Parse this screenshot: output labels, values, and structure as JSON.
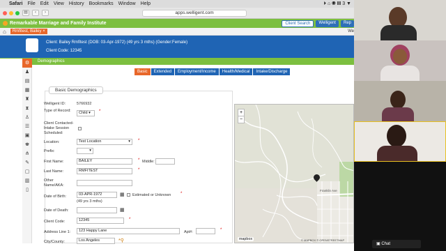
{
  "menubar": {
    "items": [
      "Safari",
      "File",
      "Edit",
      "View",
      "History",
      "Bookmarks",
      "Window",
      "Help"
    ],
    "right": "⏵ ⌂ ◉ ▤ 3 ▼"
  },
  "browser": {
    "url": "apps.welligent.com",
    "traffic_colors": [
      "#ff5f57",
      "#febc2e",
      "#28c840"
    ]
  },
  "app": {
    "title": "Remarkable Marriage and Family Institute",
    "client_search_label": "Client Search",
    "welligent_label": "Welligent",
    "rep_label": "Rep",
    "client_tab_label": "Rmfitest, Bailey",
    "welcome_text": "We",
    "client_line1": "Client: Bailey Rmfitest (DOB: 03-Apr-1972) (49 yrs 3 mths) (Gender:Female)",
    "client_line2": "Client Code: 12345",
    "section_title": "Demographics",
    "tabs": [
      "Basic",
      "Extended",
      "Employment/Income",
      "Health/Medical",
      "Intake/Discharge"
    ],
    "active_tab": "Basic"
  },
  "form": {
    "group_title": "Basic Demographics",
    "welligent_id_label": "Welligent ID:",
    "welligent_id_value": "5766932",
    "type_of_record_label": "Type of Record:",
    "type_of_record_value": "Child",
    "contacted_label": "Client Contacted-Intake Session Scheduled:",
    "location_label": "Location:",
    "location_value": "Test Location",
    "prefix_label": "Prefix:",
    "first_name_label": "First Name:",
    "first_name_value": "BAILEY",
    "middle_label": "Middle:",
    "last_name_label": "Last Name:",
    "last_name_value": "RMFITEST",
    "other_name_label": "Other Name/AKA:",
    "dob_label": "Date of Birth:",
    "dob_value": "03-APR-1972",
    "estimated_label": "Estimated or Unknown",
    "age_text": "(49 yrs 3 mths)",
    "dod_label": "Date of Death:",
    "client_code_label": "Client Code:",
    "client_code_value": "12345",
    "address1_label": "Address Line 1:",
    "address1_value": "123 Happy Lane",
    "apt_label": "Apt#:",
    "city_label": "City/County:",
    "city_value": "Los Angeles"
  },
  "map": {
    "street_label": "Franklin Ave",
    "attribution": "© MAPBOX © OPENSTREETMAP",
    "logo": "mapbox"
  },
  "chat": {
    "label": "Chat"
  }
}
